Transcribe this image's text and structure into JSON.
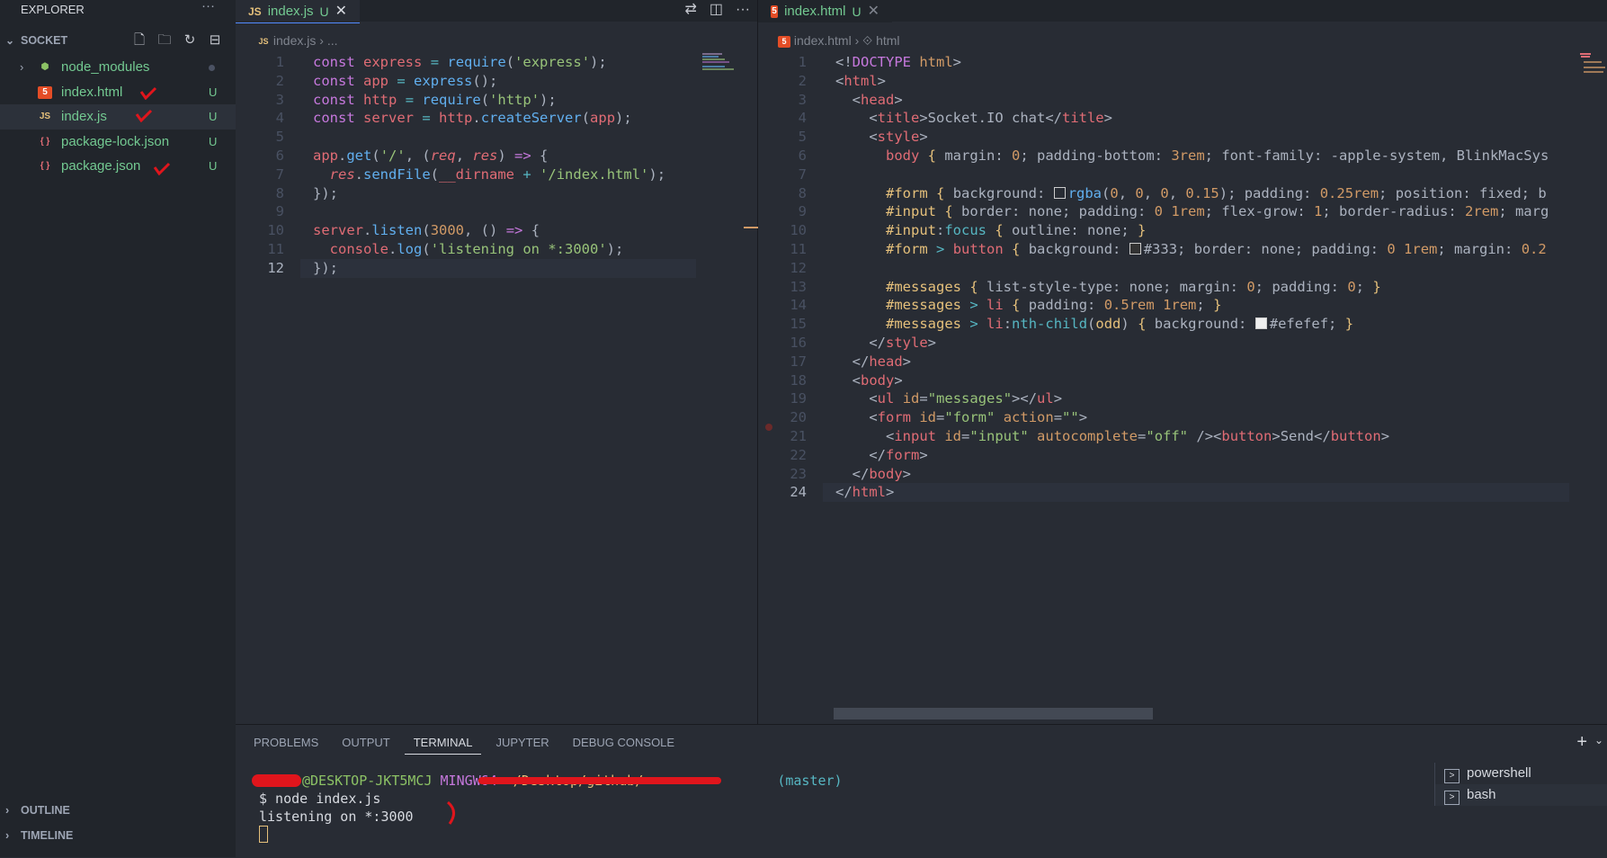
{
  "sidebar": {
    "title": "EXPLORER",
    "more": "···",
    "section": "SOCKET",
    "files": [
      {
        "name": "node_modules",
        "status": ""
      },
      {
        "name": "index.html",
        "status": "U"
      },
      {
        "name": "index.js",
        "status": "U"
      },
      {
        "name": "package-lock.json",
        "status": "U"
      },
      {
        "name": "package.json",
        "status": "U"
      }
    ],
    "outline": "OUTLINE",
    "timeline": "TIMELINE"
  },
  "editor1": {
    "tab": {
      "label": "index.js",
      "status": "U",
      "icon": "JS"
    },
    "breadcrumb": {
      "file": "index.js",
      "sep": "›",
      "rest": "..."
    },
    "current_line": 12
  },
  "editor2": {
    "tab": {
      "label": "index.html",
      "status": "U"
    },
    "breadcrumb": {
      "file": "index.html",
      "sep": "›",
      "symbol": "html"
    },
    "current_line": 24
  },
  "panel": {
    "tabs": [
      "PROBLEMS",
      "OUTPUT",
      "TERMINAL",
      "JUPYTER",
      "DEBUG CONSOLE"
    ],
    "active_tab": "TERMINAL",
    "terminal": {
      "host": "@DESKTOP-JKT5MCJ",
      "system": "MINGW64",
      "path": "~/Desktop/github/",
      "branch": "(master)",
      "command": "$ node index.js",
      "output": "listening on *:3000"
    },
    "shells": [
      "powershell",
      "bash"
    ],
    "active_shell": "bash"
  },
  "colors": {
    "accent": "#528bff",
    "untracked": "#73c991",
    "annotation": "#e0151c"
  }
}
